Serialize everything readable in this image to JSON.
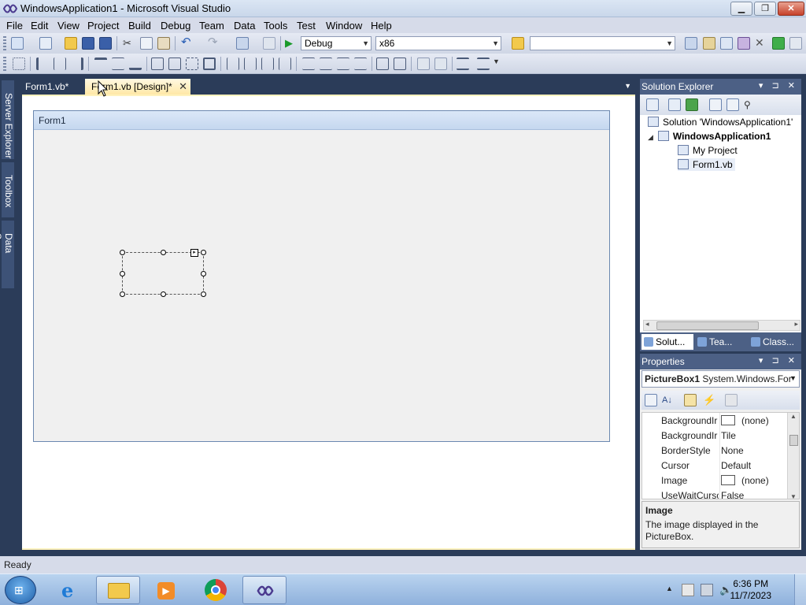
{
  "window": {
    "title": "WindowsApplication1 - Microsoft Visual Studio"
  },
  "menu": [
    "File",
    "Edit",
    "View",
    "Project",
    "Build",
    "Debug",
    "Team",
    "Data",
    "Tools",
    "Test",
    "Window",
    "Help"
  ],
  "toolbar": {
    "config_value": "Debug",
    "platform_value": "x86",
    "find_value": ""
  },
  "left_rail": [
    "Server Explorer",
    "Toolbox",
    "Data Sources"
  ],
  "doc_tabs": [
    {
      "label": "Form1.vb*",
      "active": false
    },
    {
      "label": "Form1.vb [Design]*",
      "active": true
    }
  ],
  "designer": {
    "form_caption": "Form1"
  },
  "solution_explorer": {
    "title": "Solution Explorer",
    "items": [
      {
        "label": "Solution 'WindowsApplication1'",
        "bold": false
      },
      {
        "label": "WindowsApplication1",
        "bold": true
      },
      {
        "label": "My Project",
        "bold": false
      },
      {
        "label": "Form1.vb",
        "bold": false
      }
    ],
    "expander": "◢",
    "bottom_tabs": [
      "Solut...",
      "Tea...",
      "Class..."
    ]
  },
  "properties": {
    "title": "Properties",
    "object_name": "PictureBox1",
    "object_type": "System.Windows.For",
    "rows": [
      {
        "name": "BackgroundIr",
        "value": "(none)",
        "swatch": true
      },
      {
        "name": "BackgroundIr",
        "value": "Tile",
        "swatch": false
      },
      {
        "name": "BorderStyle",
        "value": "None",
        "swatch": false
      },
      {
        "name": "Cursor",
        "value": "Default",
        "swatch": false
      },
      {
        "name": "Image",
        "value": "(none)",
        "swatch": true
      },
      {
        "name": "UseWaitCursc",
        "value": "False",
        "swatch": false
      }
    ],
    "desc_title": "Image",
    "desc_text": "The image displayed in the PictureBox."
  },
  "status": {
    "text": "Ready"
  },
  "taskbar": {
    "time": "6:36 PM",
    "date": "11/7/2023"
  },
  "colors": {
    "chrome_dark": "#2b3c59",
    "panel_title": "#4c6085",
    "active_tab": "#ffe8a6"
  }
}
